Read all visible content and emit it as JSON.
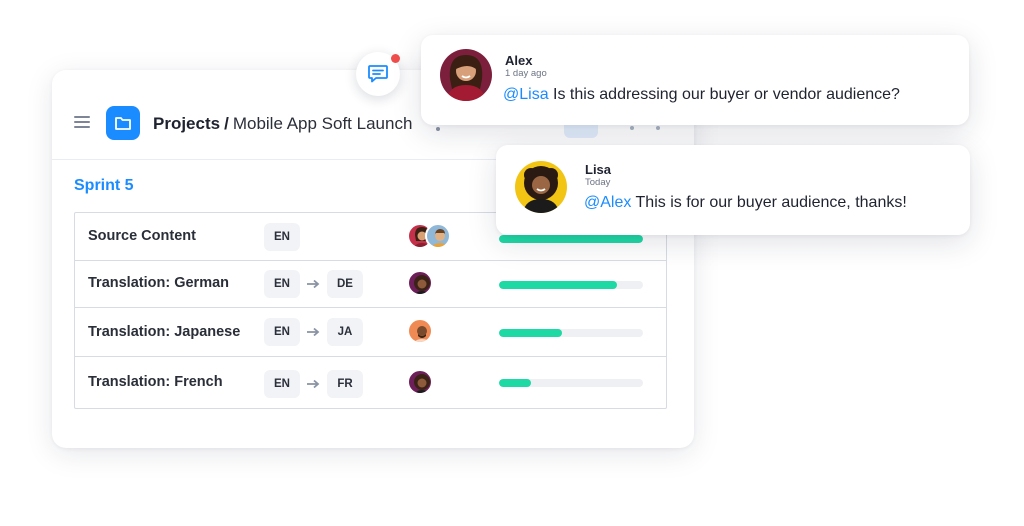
{
  "project": {
    "breadcrumb_root": "Projects",
    "breadcrumb_separator": "/",
    "page_title": "Mobile App Soft Launch",
    "sprint_title": "Sprint 5"
  },
  "tasks": [
    {
      "name": "Source Content",
      "source_lang": "EN",
      "target_lang": "",
      "progress": 1.0
    },
    {
      "name": "Translation: German",
      "source_lang": "EN",
      "target_lang": "DE",
      "progress": 0.82
    },
    {
      "name": "Translation: Japanese",
      "source_lang": "EN",
      "target_lang": "JA",
      "progress": 0.44
    },
    {
      "name": "Translation: French",
      "source_lang": "EN",
      "target_lang": "FR",
      "progress": 0.22
    }
  ],
  "comments": [
    {
      "author": "Alex",
      "time": "1 day ago",
      "mention": "@Lisa",
      "text": " Is this addressing our buyer or vendor audience?"
    },
    {
      "author": "Lisa",
      "time": "Today",
      "mention": "@Alex",
      "text": " This is for our buyer audience, thanks!"
    }
  ],
  "colors": {
    "accent": "#1a8cff",
    "progress": "#1fd9a4",
    "notification": "#ef4c4c",
    "connector": "#2fd3a0"
  }
}
